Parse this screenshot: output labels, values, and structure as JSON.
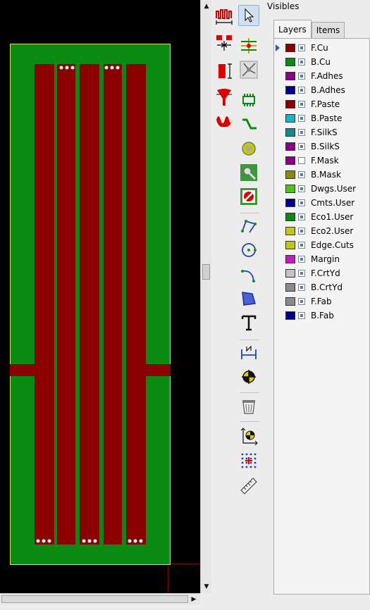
{
  "panel": {
    "title": "Visibles",
    "tabs": [
      "Layers",
      "Items"
    ],
    "selected_tab": "Layers"
  },
  "layers": [
    {
      "name": "F.Cu",
      "color": "#8b0000",
      "visible": true,
      "active": true
    },
    {
      "name": "B.Cu",
      "color": "#0a8a12",
      "visible": true,
      "active": false
    },
    {
      "name": "F.Adhes",
      "color": "#8a008a",
      "visible": true,
      "active": false
    },
    {
      "name": "B.Adhes",
      "color": "#00008b",
      "visible": true,
      "active": false
    },
    {
      "name": "F.Paste",
      "color": "#8b0000",
      "visible": true,
      "active": false
    },
    {
      "name": "B.Paste",
      "color": "#19b4c4",
      "visible": true,
      "active": false
    },
    {
      "name": "F.SilkS",
      "color": "#108a8a",
      "visible": true,
      "active": false
    },
    {
      "name": "B.SilkS",
      "color": "#8a008a",
      "visible": true,
      "active": false
    },
    {
      "name": "F.Mask",
      "color": "#8a008a",
      "visible": false,
      "active": false
    },
    {
      "name": "B.Mask",
      "color": "#8a8a10",
      "visible": true,
      "active": false
    },
    {
      "name": "Dwgs.User",
      "color": "#4cc41a",
      "visible": true,
      "active": false
    },
    {
      "name": "Cmts.User",
      "color": "#00008b",
      "visible": true,
      "active": false
    },
    {
      "name": "Eco1.User",
      "color": "#0a8a12",
      "visible": true,
      "active": false
    },
    {
      "name": "Eco2.User",
      "color": "#c4c41a",
      "visible": true,
      "active": false
    },
    {
      "name": "Edge.Cuts",
      "color": "#c4c41a",
      "visible": true,
      "active": false
    },
    {
      "name": "Margin",
      "color": "#c41ac4",
      "visible": true,
      "active": false
    },
    {
      "name": "F.CrtYd",
      "color": "#c4c4c4",
      "visible": true,
      "active": false
    },
    {
      "name": "B.CrtYd",
      "color": "#8a8a8a",
      "visible": true,
      "active": false
    },
    {
      "name": "F.Fab",
      "color": "#8a8a8a",
      "visible": true,
      "active": false
    },
    {
      "name": "B.Fab",
      "color": "#00008b",
      "visible": true,
      "active": false
    }
  ],
  "colors": {
    "canvas_background": "#000000",
    "board_copper_back": "#0a8a12",
    "board_copper_front": "#8b0000",
    "board_outline": "#d8e06a"
  },
  "toolbar_left": [
    {
      "icon": "microwave-tools-icon"
    },
    {
      "icon": "microwave-gap-icon"
    },
    {
      "icon": "microwave-stub-icon"
    },
    {
      "icon": "microwave-arc-stub-icon"
    },
    {
      "icon": "microwave-polygon-shape-icon"
    }
  ],
  "toolbar_right": [
    {
      "icon": "select-pointer-icon",
      "active": true
    },
    {
      "icon": "highlight-net-icon"
    },
    {
      "icon": "local-ratsnest-icon"
    },
    {
      "icon": "add-footprint-icon"
    },
    {
      "icon": "route-track-icon"
    },
    {
      "icon": "add-via-icon"
    },
    {
      "icon": "add-zone-icon"
    },
    {
      "icon": "add-keepout-icon"
    },
    {
      "icon": "add-line-icon"
    },
    {
      "icon": "add-circle-icon"
    },
    {
      "icon": "add-arc-icon"
    },
    {
      "icon": "add-polygon-icon"
    },
    {
      "icon": "add-text-icon"
    },
    {
      "icon": "add-dimension-icon"
    },
    {
      "icon": "add-target-icon"
    },
    {
      "icon": "delete-icon"
    },
    {
      "icon": "set-origin-icon"
    },
    {
      "icon": "grid-origin-icon"
    },
    {
      "icon": "measure-icon"
    }
  ]
}
